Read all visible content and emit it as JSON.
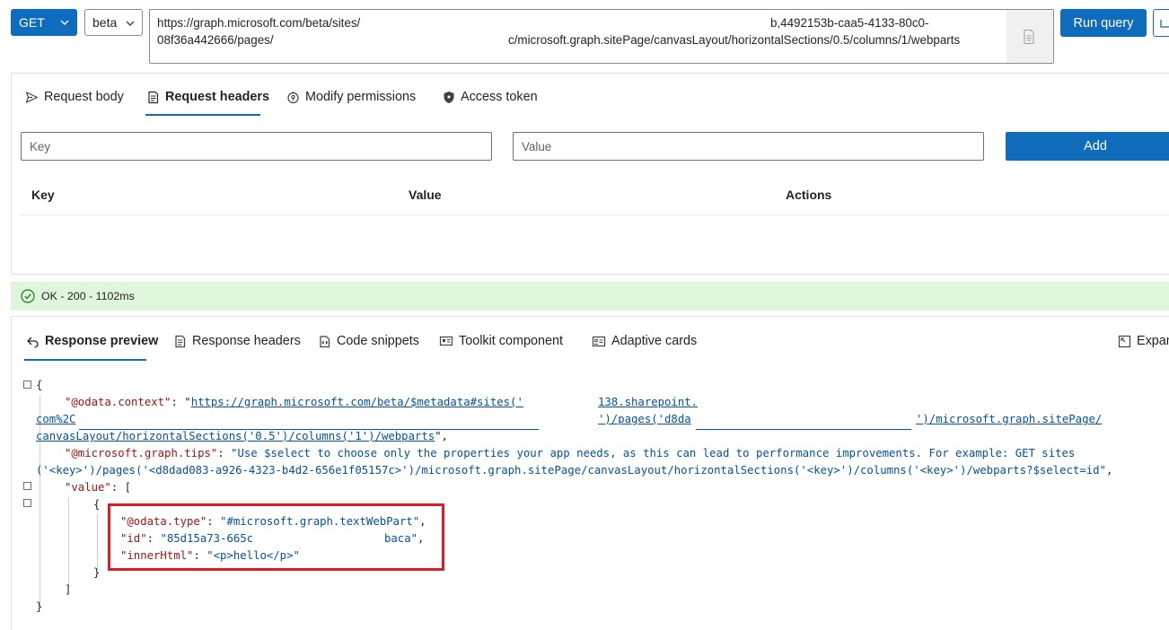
{
  "query_bar": {
    "method": "GET",
    "version": "beta",
    "url_line1_start": "https://graph.microsoft.com/beta/sites/",
    "url_line1_end": "b,4492153b-caa5-4133-80c0-",
    "url_line2_start": "08f36a442666/pages/",
    "url_line2_end": "c/microsoft.graph.sitePage/canvasLayout/horizontalSections/0.5/columns/1/webparts",
    "run_label": "Run query"
  },
  "request": {
    "tabs": [
      {
        "label": "Request body",
        "icon": "send-icon"
      },
      {
        "label": "Request headers",
        "icon": "headers-icon",
        "active": true
      },
      {
        "label": "Modify permissions",
        "icon": "permissions-icon"
      },
      {
        "label": "Access token",
        "icon": "lock-icon"
      }
    ],
    "key_placeholder": "Key",
    "value_placeholder": "Value",
    "add_label": "Add",
    "columns": [
      "Key",
      "Value",
      "Actions"
    ]
  },
  "status": {
    "text": "OK - 200 - 1102ms",
    "color": "#dff6dd"
  },
  "response": {
    "tabs": [
      {
        "label": "Response preview",
        "icon": "back-arrow-icon",
        "active": true
      },
      {
        "label": "Response headers",
        "icon": "headers-icon"
      },
      {
        "label": "Code snippets",
        "icon": "snippet-icon"
      },
      {
        "label": "Toolkit component",
        "icon": "toolkit-icon"
      },
      {
        "label": "Adaptive cards",
        "icon": "card-icon"
      }
    ],
    "expand_label": "Expan"
  },
  "json": {
    "open_brace": "{",
    "context_key": "\"@odata.context\"",
    "context_url_part1": "https://graph.microsoft.com/beta/$metadata#sites('",
    "context_url_part2": "138.sharepoint.",
    "context_line2_start": "com%2C",
    "context_line2_mid": "')/pages('d8da",
    "context_line2_end": "')/microsoft.graph.sitePage/",
    "context_line3": "canvasLayout/horizontalSections('0.5')/columns('1')/webparts",
    "tips_key": "\"@microsoft.graph.tips\"",
    "tips_line1": "\"Use $select to choose only the properties your app needs, as this can lead to performance improvements. For example: GET sites",
    "tips_line2": "('<key>')/pages('<d8dad083-a926-4323-b4d2-656e1f05157c>')/microsoft.graph.sitePage/canvasLayout/horizontalSections('<key>')/columns('<key>')/webparts?$select=id\"",
    "value_key": "\"value\"",
    "type_key": "\"@odata.type\"",
    "type_value": "\"#microsoft.graph.textWebPart\"",
    "id_key": "\"id\"",
    "id_value_start": "\"85d15a73-665c",
    "id_value_end": "baca\"",
    "html_key": "\"innerHtml\"",
    "html_value": "\"<p>hello</p>\"",
    "highlight_color": "#e01b24"
  },
  "colors": {
    "accent": "#0f6cbd",
    "json_key": "#a31515",
    "json_string": "#0451a5"
  }
}
